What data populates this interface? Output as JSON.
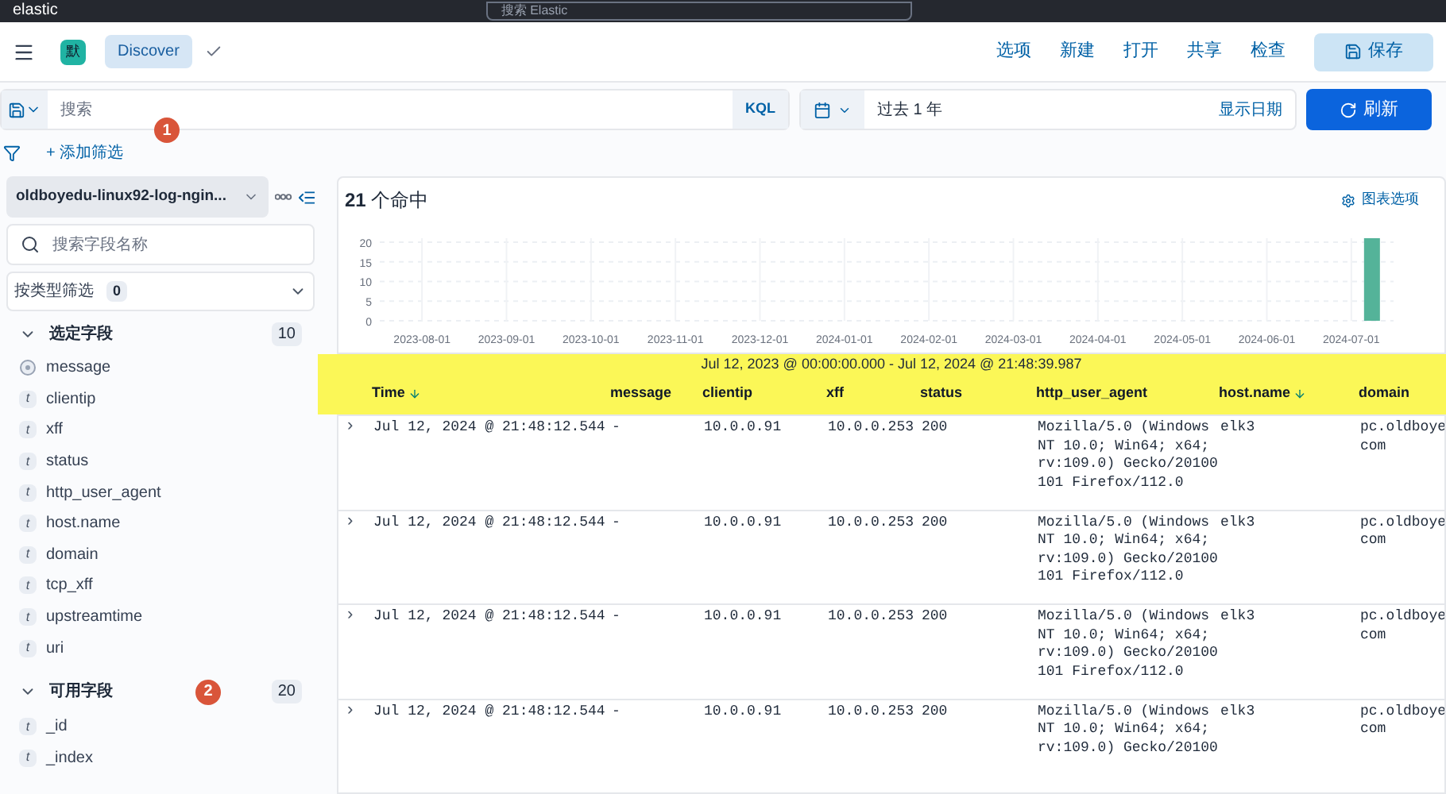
{
  "header": {
    "logo": "elastic",
    "search_placeholder": "搜索 Elastic"
  },
  "app_bar": {
    "space_initial": "默",
    "app": "Discover",
    "menu": [
      "选项",
      "新建",
      "打开",
      "共享",
      "检查"
    ],
    "save": "保存"
  },
  "query_bar": {
    "placeholder": "搜索",
    "language": "KQL",
    "time_range": "过去 1 年",
    "show_dates": "显示日期",
    "refresh": "刷新"
  },
  "add_filter": "+ 添加筛选",
  "annotations": [
    {
      "label": "1"
    },
    {
      "label": "2"
    }
  ],
  "sidebar": {
    "index_pattern": "oldboyedu-linux92-log-ngin...",
    "search_placeholder": "搜索字段名称",
    "type_filter": {
      "label": "按类型筛选",
      "count": "0"
    },
    "selected": {
      "title": "选定字段",
      "count": "10",
      "expanded": true,
      "fields": [
        {
          "kind": "unknown",
          "name": "message"
        },
        {
          "kind": "text",
          "type": "t",
          "name": "clientip"
        },
        {
          "kind": "text",
          "type": "t",
          "name": "xff"
        },
        {
          "kind": "text",
          "type": "t",
          "name": "status"
        },
        {
          "kind": "text",
          "type": "t",
          "name": "http_user_agent"
        },
        {
          "kind": "text",
          "type": "t",
          "name": "host.name"
        },
        {
          "kind": "text",
          "type": "t",
          "name": "domain"
        },
        {
          "kind": "text",
          "type": "t",
          "name": "tcp_xff"
        },
        {
          "kind": "text",
          "type": "t",
          "name": "upstreamtime"
        },
        {
          "kind": "text",
          "type": "t",
          "name": "uri"
        }
      ]
    },
    "available": {
      "title": "可用字段",
      "count": "20",
      "expanded": true,
      "fields": [
        {
          "kind": "text",
          "type": "t",
          "name": "_id"
        },
        {
          "kind": "text",
          "type": "t",
          "name": "_index"
        }
      ]
    }
  },
  "hits": {
    "count": "21",
    "label": "个命中"
  },
  "chart_options": "图表选项",
  "chart_data": {
    "type": "bar",
    "categories": [
      "2023-08-01",
      "2023-09-01",
      "2023-10-01",
      "2023-11-01",
      "2023-12-01",
      "2024-01-01",
      "2024-02-01",
      "2024-03-01",
      "2024-04-01",
      "2024-05-01",
      "2024-06-01",
      "2024-07-01"
    ],
    "grid": true,
    "series": [
      {
        "color": "#54b399",
        "values": [
          0,
          0,
          0,
          0,
          0,
          0,
          0,
          0,
          0,
          0,
          0,
          21
        ]
      }
    ],
    "ylim": [
      0,
      21
    ],
    "yticks": [
      0,
      5,
      10,
      15,
      20
    ]
  },
  "time_span": "Jul 12, 2023 @ 00:00:00.000 - Jul 12, 2024 @ 21:48:39.987",
  "table": {
    "columns": [
      {
        "label": "Time",
        "sorted": true
      },
      {
        "label": "message",
        "sorted": false
      },
      {
        "label": "clientip",
        "sorted": false
      },
      {
        "label": "xff",
        "sorted": false
      },
      {
        "label": "status",
        "sorted": false
      },
      {
        "label": "http_user_agent",
        "sorted": false
      },
      {
        "label": "host.name",
        "sorted": true
      },
      {
        "label": "domain",
        "sorted": false
      }
    ],
    "rows": [
      {
        "expand": "›",
        "cells": [
          [
            "Jul 12, 2024 @ 21:48:12.544"
          ],
          [
            "-"
          ],
          [
            "10.0.0.91"
          ],
          [
            "10.0.0.253"
          ],
          [
            "200"
          ],
          [
            "Mozilla/5.0 (Windows",
            "NT 10.0; Win64; x64;",
            "rv:109.0) Gecko/20100",
            "101 Firefox/112.0"
          ],
          [
            "elk3"
          ],
          [
            "pc.oldboye",
            "com"
          ]
        ]
      },
      {
        "expand": "›",
        "cells": [
          [
            "Jul 12, 2024 @ 21:48:12.544"
          ],
          [
            "-"
          ],
          [
            "10.0.0.91"
          ],
          [
            "10.0.0.253"
          ],
          [
            "200"
          ],
          [
            "Mozilla/5.0 (Windows",
            "NT 10.0; Win64; x64;",
            "rv:109.0) Gecko/20100",
            "101 Firefox/112.0"
          ],
          [
            "elk3"
          ],
          [
            "pc.oldboye",
            "com"
          ]
        ]
      },
      {
        "expand": "›",
        "cells": [
          [
            "Jul 12, 2024 @ 21:48:12.544"
          ],
          [
            "-"
          ],
          [
            "10.0.0.91"
          ],
          [
            "10.0.0.253"
          ],
          [
            "200"
          ],
          [
            "Mozilla/5.0 (Windows",
            "NT 10.0; Win64; x64;",
            "rv:109.0) Gecko/20100",
            "101 Firefox/112.0"
          ],
          [
            "elk3"
          ],
          [
            "pc.oldboye",
            "com"
          ]
        ]
      },
      {
        "expand": "›",
        "cells": [
          [
            "Jul 12, 2024 @ 21:48:12.544"
          ],
          [
            "-"
          ],
          [
            "10.0.0.91"
          ],
          [
            "10.0.0.253"
          ],
          [
            "200"
          ],
          [
            "Mozilla/5.0 (Windows",
            "NT 10.0; Win64; x64;",
            "rv:109.0) Gecko/20100"
          ],
          [
            "elk3"
          ],
          [
            "pc.oldboye",
            "com"
          ]
        ]
      }
    ]
  }
}
